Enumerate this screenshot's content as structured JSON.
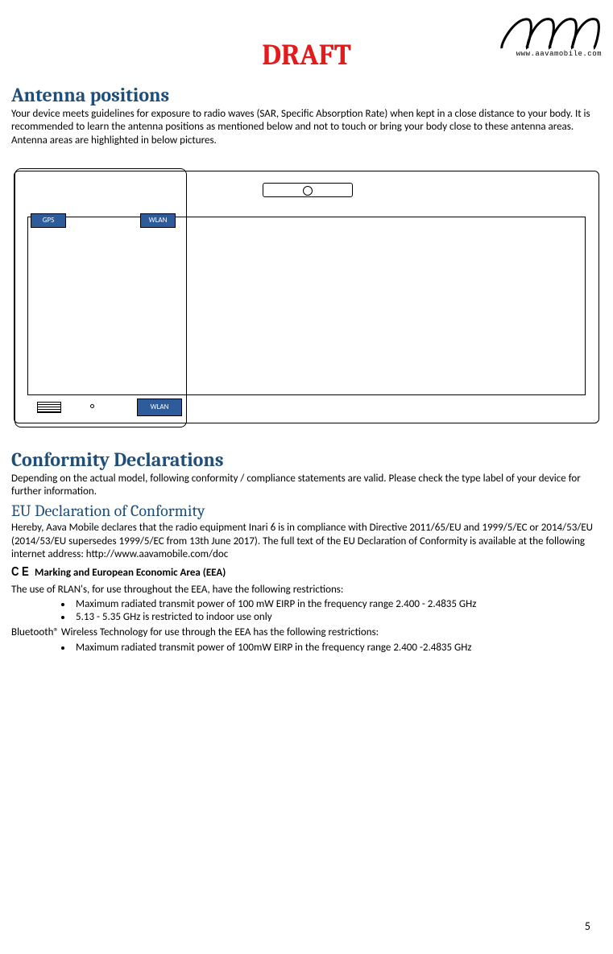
{
  "header": {
    "draft_label": "DRAFT",
    "logo_url_text": "www.aavamobile.com"
  },
  "antenna": {
    "heading": "Antenna positions",
    "body": "Your device meets guidelines for exposure to radio waves (SAR, Specific Absorption Rate) when kept in a close distance to your body. It is recommended to learn the antenna positions as mentioned below and not to touch or bring your body close to these antenna areas. Antenna areas are highlighted in below pictures.",
    "callouts": {
      "gps": "GPS",
      "wlan_top": "WLAN",
      "wlan_bottom": "WLAN"
    }
  },
  "conformity": {
    "heading": "Conformity Declarations",
    "intro": "Depending on the actual model, following conformity / compliance statements are valid. Please check the type label of your device for further information.",
    "eu_heading": "EU Declaration of Conformity",
    "eu_body": "Hereby, Aava Mobile declares that the radio equipment Inari 6 is in compliance with Directive 2011/65/EU and 1999/5/EC or 2014/53/EU (2014/53/EU supersedes 1999/5/EC from 13th June 2017).  The full text of the EU Declaration of Conformity is available at the following internet address: http://www.aavamobile.com/doc",
    "ce_title": "Marking and European Economic Area (EEA)",
    "rlan_intro": "The use of RLAN's, for use throughout the EEA, have the following restrictions:",
    "rlan_bullets": [
      "Maximum radiated transmit power of 100 mW EIRP in the frequency range 2.400 - 2.4835 GHz",
      "5.13 - 5.35 GHz is restricted to indoor use only"
    ],
    "bt_intro": "Bluetooth® Wireless Technology for use through the EEA has the following restrictions:",
    "bt_bullets": [
      "Maximum radiated transmit power of 100mW EIRP in the frequency range 2.400 -2.4835 GHz"
    ]
  },
  "page_number": "5"
}
